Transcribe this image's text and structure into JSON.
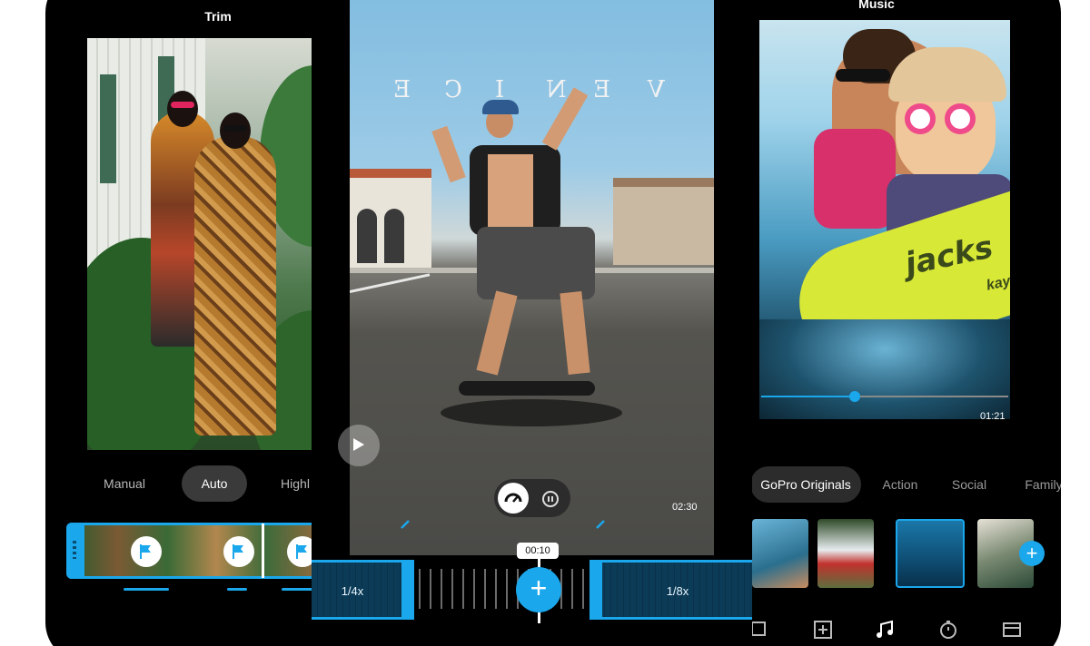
{
  "trim_screen": {
    "title": "Trim",
    "modes": [
      "Manual",
      "Auto",
      "Highl"
    ],
    "active_mode": "Auto"
  },
  "speed_screen": {
    "current_time": "00:10",
    "clip_duration": "02:30",
    "segments": [
      {
        "label": "1/4x"
      },
      {
        "label": "1/8x"
      }
    ]
  },
  "music_screen": {
    "title": "Music",
    "elapsed": "01:21",
    "progress": 0.38,
    "categories": [
      "GoPro Originals",
      "Action",
      "Social",
      "Family"
    ],
    "active_category": "GoPro Originals",
    "kayak_brand": "jacks",
    "kayak_brand_line2": "kay"
  },
  "colors": {
    "accent": "#1aa7ec",
    "phone_body": "#000000",
    "pill_bg": "#2c2c2c"
  },
  "icons": {
    "play": "play-icon",
    "add": "plus-icon",
    "flag": "flag-icon",
    "speed_mode": "speedometer-icon",
    "timer_mode": "stopwatch-icon",
    "music_nav": "music-note-icon"
  }
}
